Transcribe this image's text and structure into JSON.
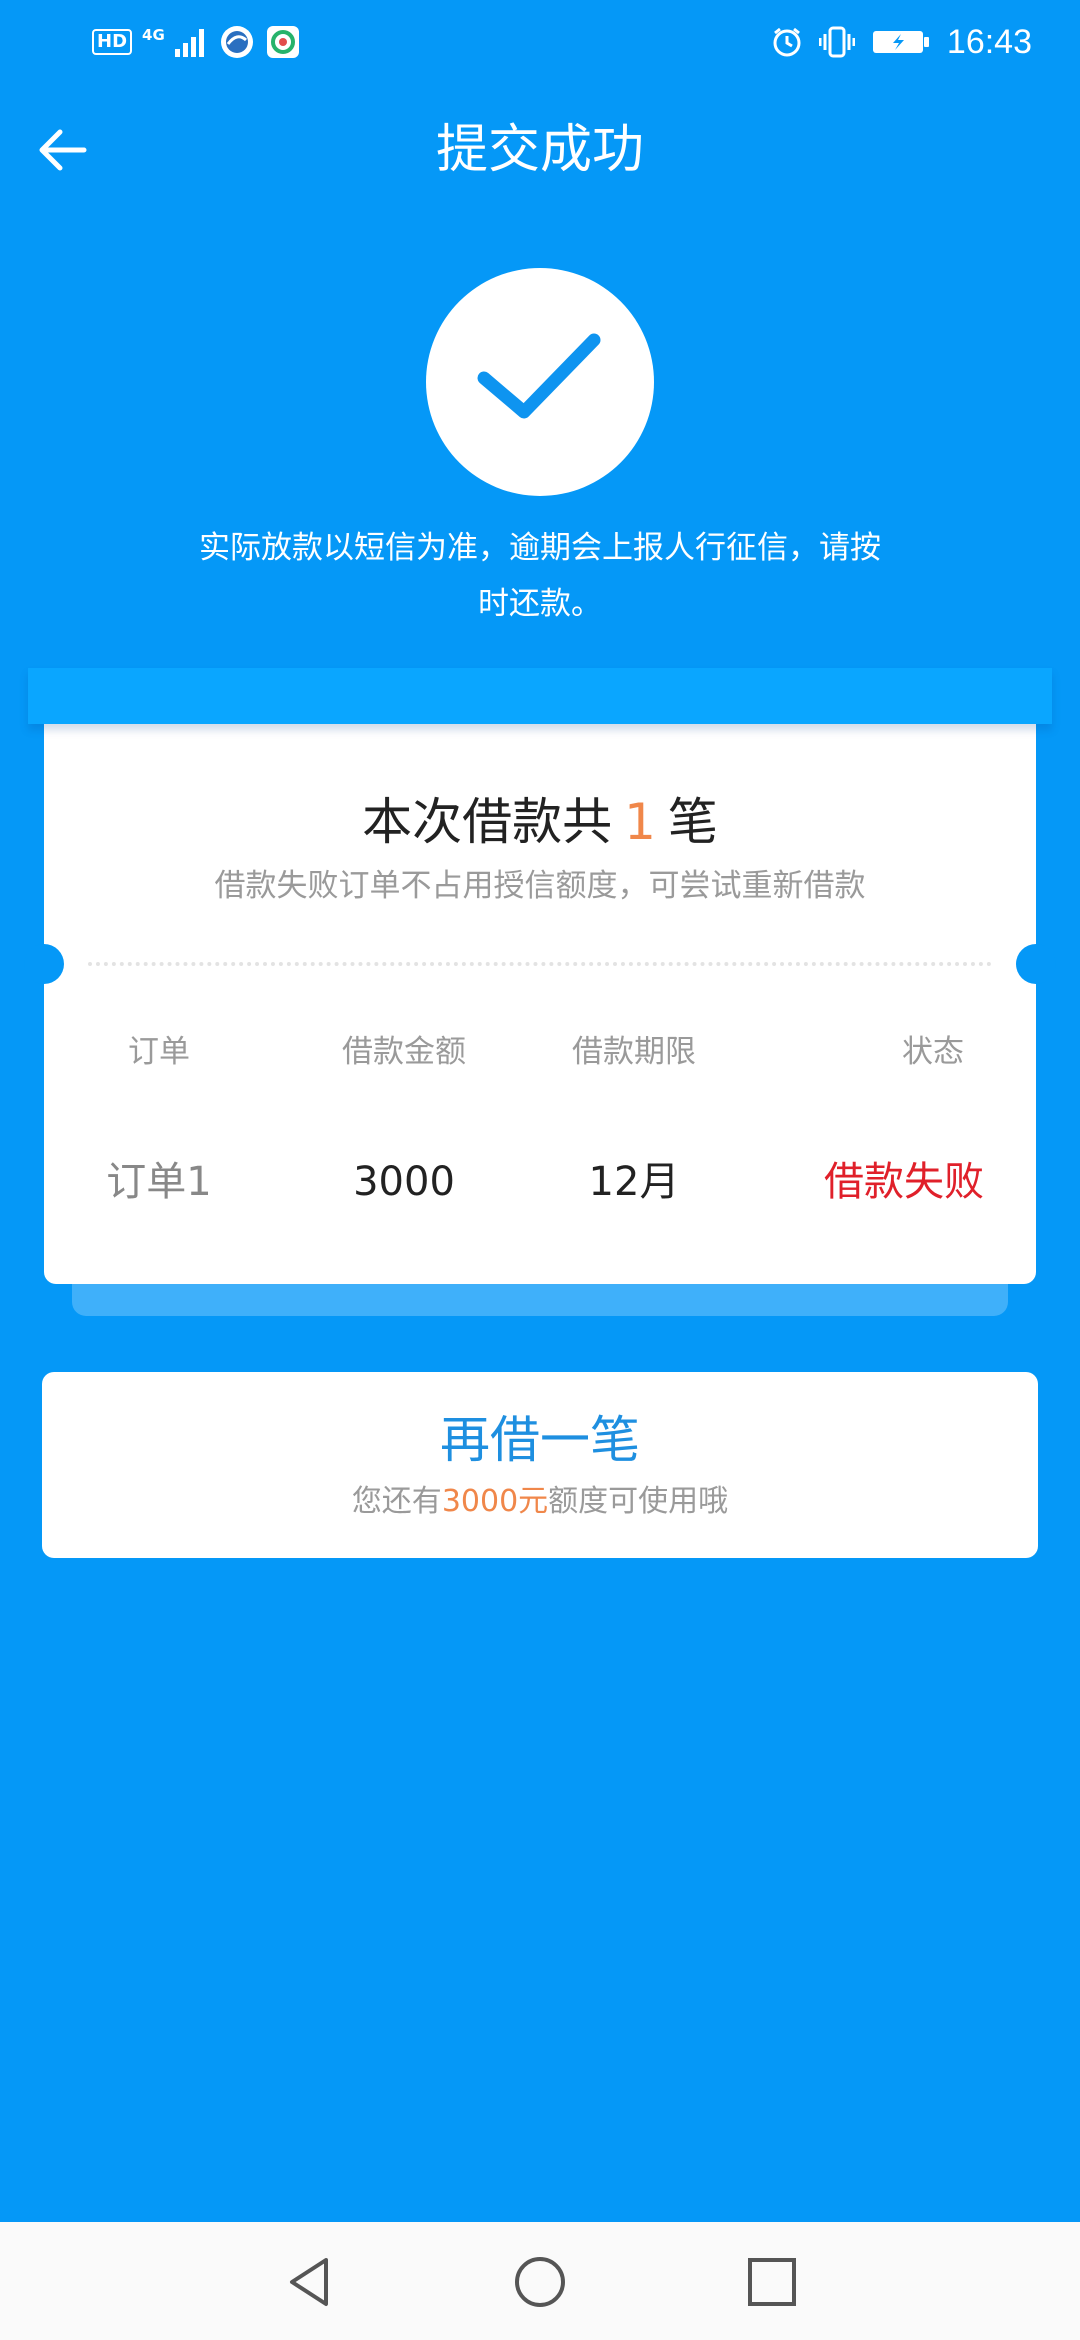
{
  "status_bar": {
    "hd": "HD",
    "network": "4G",
    "time": "16:43"
  },
  "header": {
    "title": "提交成功"
  },
  "notice": {
    "line1": "实际放款以短信为准，逾期会上报人行征信，请按",
    "line2": "时还款。"
  },
  "summary": {
    "prefix": "本次借款共",
    "count": "1",
    "suffix": "笔",
    "subtitle": "借款失败订单不占用授信额度，可尝试重新借款"
  },
  "table": {
    "headers": [
      "订单",
      "借款金额",
      "借款期限",
      "状态"
    ],
    "rows": [
      [
        "订单1",
        "3000",
        "12月",
        "借款失败"
      ]
    ]
  },
  "borrow_again": {
    "title": "再借一笔",
    "sub_prefix": "您还有",
    "sub_amount": "3000元",
    "sub_suffix": "额度可使用哦"
  },
  "colors": {
    "background": "#0598F7",
    "accent_orange": "#F0874A",
    "fail_red": "#E0202A",
    "link_blue": "#1E8FE0"
  },
  "icons": {
    "back": "arrow-left-icon",
    "success": "checkmark-icon",
    "nav": [
      "triangle-back-icon",
      "circle-home-icon",
      "square-recent-icon"
    ]
  }
}
